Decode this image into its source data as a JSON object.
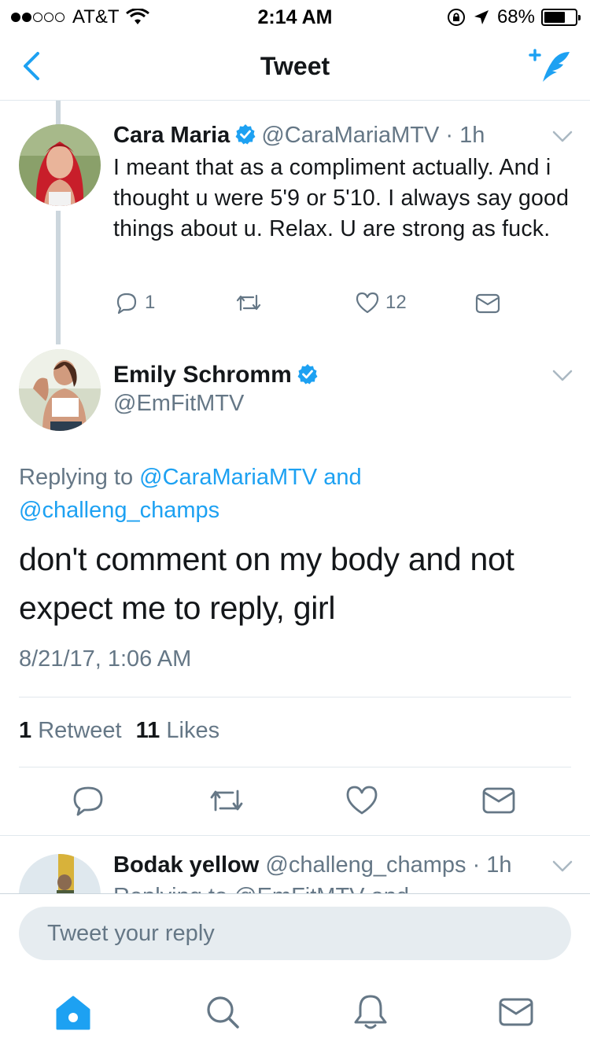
{
  "status_bar": {
    "carrier": "AT&T",
    "signal_bars_filled": 2,
    "signal_bars_total": 5,
    "time": "2:14 AM",
    "battery": "68%",
    "battery_level": 0.68,
    "icons": [
      "wifi-icon",
      "rotation-lock-icon",
      "location-arrow-icon",
      "battery-icon"
    ]
  },
  "nav": {
    "title": "Tweet",
    "back_icon": "chevron-left-icon",
    "compose_icon": "compose-tweet-icon",
    "accent": "#1da1f2"
  },
  "parent_tweet": {
    "name": "Cara Maria",
    "verified": true,
    "handle": "@CaraMariaMTV",
    "age": "· 1h",
    "text": "I meant that as a compliment actually. And i thought u were 5'9 or 5'10. I always say good things about u. Relax. U are strong as fuck.",
    "replies": "1",
    "retweets": "",
    "likes": "12"
  },
  "main_tweet": {
    "name": "Emily Schromm",
    "verified": true,
    "handle": "@EmFitMTV",
    "replying_prefix": "Replying to",
    "replying_handle_1": "@CaraMariaMTV",
    "replying_and": "and",
    "replying_handle_2": "@challeng_champs",
    "text": "don't comment on my body and not expect me to reply, girl",
    "timestamp": "8/21/17, 1:06 AM",
    "retweet_count": "1",
    "retweet_label": "Retweet",
    "like_count": "11",
    "like_label": "Likes"
  },
  "reply_tweet": {
    "name": "Bodak yellow",
    "handle": "@challeng_champs",
    "age": "· 1h",
    "partial_text": "Replying to @EmFitMTV and"
  },
  "composer": {
    "placeholder": "Tweet your reply"
  },
  "tab_bar": {
    "tabs": [
      "home-icon",
      "search-icon",
      "notifications-icon",
      "messages-icon"
    ],
    "active": "home-icon"
  },
  "colors": {
    "accent": "#1da1f2",
    "muted": "#657786",
    "divider": "#e1e8ed",
    "thread_line": "#ccd6dd"
  }
}
